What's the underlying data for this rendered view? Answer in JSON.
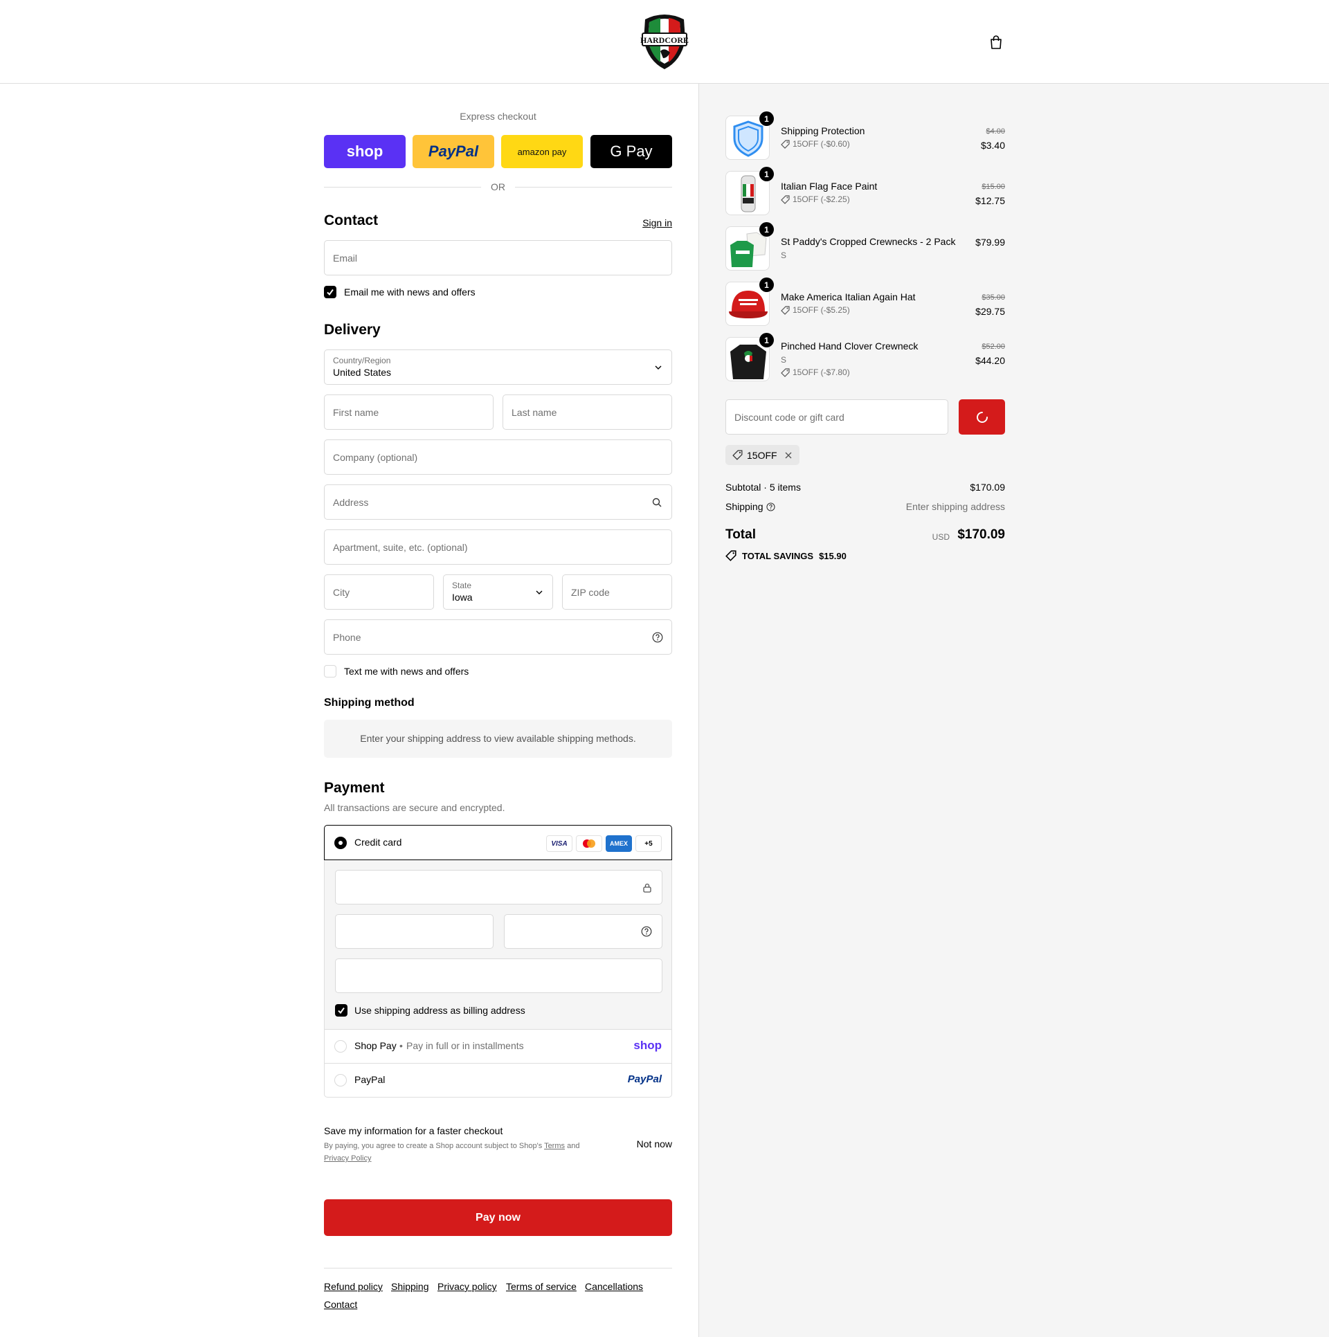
{
  "header": {
    "logo_alt": "HARDCORE ITALIANS",
    "cart_icon": "shopping-bag-icon"
  },
  "express": {
    "title": "Express checkout",
    "buttons": [
      {
        "label": "shop",
        "bg": "#5a31f4",
        "color": "#ffffff"
      },
      {
        "label": "PayPal",
        "bg": "#ffc439",
        "color": "#003087"
      },
      {
        "label": "amazon pay",
        "bg": "#ffd814",
        "color": "#0f1111"
      },
      {
        "label": "G Pay",
        "bg": "#000000",
        "color": "#ffffff"
      }
    ],
    "or": "OR"
  },
  "contact": {
    "heading": "Contact",
    "sign_in": "Sign in",
    "email_placeholder": "Email",
    "email_opt_in": "Email me with news and offers"
  },
  "delivery": {
    "heading": "Delivery",
    "country_label": "Country/Region",
    "country_value": "United States",
    "first_name": "First name",
    "last_name": "Last name",
    "company": "Company (optional)",
    "address": "Address",
    "apartment": "Apartment, suite, etc. (optional)",
    "city": "City",
    "state_label": "State",
    "state_value": "Iowa",
    "zip": "ZIP code",
    "phone": "Phone",
    "text_opt_in": "Text me with news and offers"
  },
  "shipping_method": {
    "heading": "Shipping method",
    "info": "Enter your shipping address to view available shipping methods."
  },
  "payment": {
    "heading": "Payment",
    "subtitle": "All transactions are secure and encrypted.",
    "credit_card": "Credit card",
    "card_logos": [
      "VISA",
      "Mastercard",
      "AMEX",
      "+5"
    ],
    "billing_same": "Use shipping address as billing address",
    "shop_pay": "Shop Pay",
    "shop_pay_desc": "Pay in full or in installments",
    "shop_pay_logo": "shop",
    "paypal": "PayPal",
    "paypal_logo": "PayPal"
  },
  "save_info": {
    "title": "Save my information for a faster checkout",
    "legal_prefix": "By paying, you agree to create a Shop account subject to Shop's",
    "terms": "Terms",
    "and": "and",
    "privacy": "Privacy Policy",
    "not_now": "Not now"
  },
  "pay_now": "Pay now",
  "footer_links": [
    "Refund policy",
    "Shipping",
    "Privacy policy",
    "Terms of service",
    "Cancellations",
    "Contact"
  ],
  "order": {
    "items": [
      {
        "name": "Shipping Protection",
        "qty": "1",
        "discount": "15OFF (-$0.60)",
        "variant": "",
        "original": "$4.00",
        "price": "$3.40"
      },
      {
        "name": "Italian Flag Face Paint",
        "qty": "1",
        "discount": "15OFF (-$2.25)",
        "variant": "",
        "original": "$15.00",
        "price": "$12.75"
      },
      {
        "name": "St Paddy's Cropped Crewnecks - 2 Pack",
        "qty": "1",
        "discount": "",
        "variant": "S",
        "original": "",
        "price": "$79.99"
      },
      {
        "name": "Make America Italian Again Hat",
        "qty": "1",
        "discount": "15OFF (-$5.25)",
        "variant": "",
        "original": "$35.00",
        "price": "$29.75"
      },
      {
        "name": "Pinched Hand Clover Crewneck",
        "qty": "1",
        "discount": "15OFF (-$7.80)",
        "variant": "S",
        "original": "$52.00",
        "price": "$44.20"
      }
    ],
    "discount_placeholder": "Discount code or gift card",
    "applied_code": "15OFF",
    "subtotal_label": "Subtotal · 5 items",
    "subtotal": "$170.09",
    "shipping_label": "Shipping",
    "shipping_value": "Enter shipping address",
    "total_label": "Total",
    "currency": "USD",
    "total": "$170.09",
    "savings_label": "TOTAL SAVINGS",
    "savings": "$15.90"
  },
  "colors": {
    "accent": "#d41b1b",
    "shop_purple": "#5a31f4"
  }
}
